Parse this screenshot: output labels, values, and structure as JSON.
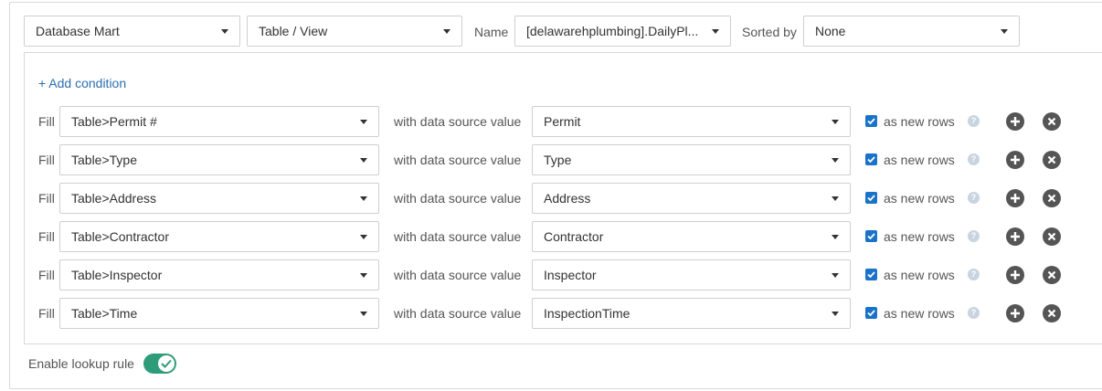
{
  "toolbar": {
    "source_select": "Database Mart",
    "type_select": "Table / View",
    "name_label": "Name",
    "name_select": "[delawarehplumbing].DailyPl...",
    "sorted_label": "Sorted by",
    "sorted_select": "None"
  },
  "conditions": {
    "add_label": "+ Add condition",
    "fill_label": "Fill",
    "with_label": "with data source value",
    "new_rows_label": "as new rows",
    "help_glyph": "?",
    "rows": [
      {
        "target": "Table>Permit #",
        "source": "Permit",
        "as_new_rows": true
      },
      {
        "target": "Table>Type",
        "source": "Type",
        "as_new_rows": true
      },
      {
        "target": "Table>Address",
        "source": "Address",
        "as_new_rows": true
      },
      {
        "target": "Table>Contractor",
        "source": "Contractor",
        "as_new_rows": true
      },
      {
        "target": "Table>Inspector",
        "source": "Inspector",
        "as_new_rows": true
      },
      {
        "target": "Table>Time",
        "source": "InspectionTime",
        "as_new_rows": true
      }
    ]
  },
  "footer": {
    "lookup_label": "Enable lookup rule",
    "lookup_enabled": true
  },
  "icons": {
    "dropdown": "caret-down-icon",
    "add": "plus-circle-icon",
    "remove": "x-circle-icon",
    "help": "question-circle-icon",
    "toggle_on": "check-icon"
  },
  "colors": {
    "link": "#2a6fb0",
    "checkbox": "#1a73c9",
    "toggle": "#2f9c79",
    "action_button": "#555555"
  }
}
